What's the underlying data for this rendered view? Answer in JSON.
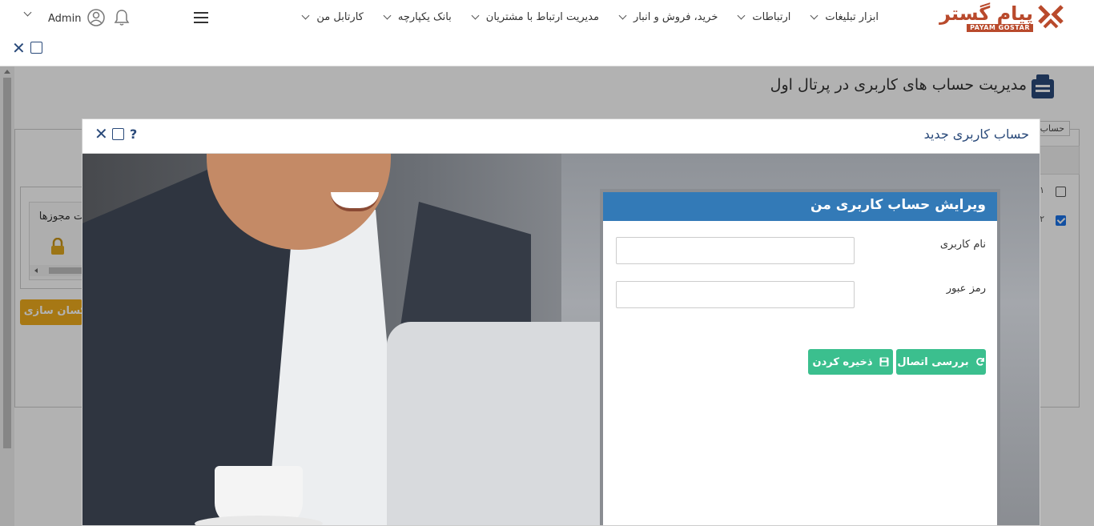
{
  "topbar": {
    "logo_text": "پیام گستر",
    "logo_sub": "PAYAM GOSTAR",
    "menu": [
      {
        "label": "کارتابل من"
      },
      {
        "label": "بانک یکپارچه"
      },
      {
        "label": "مدیریت ارتباط با مشتریان"
      },
      {
        "label": "خرید، فروش و انبار"
      },
      {
        "label": "ارتباطات"
      },
      {
        "label": "ابزار تبلیغات"
      }
    ],
    "user_name": "Admin"
  },
  "outer_window": {
    "close_glyph": "✕"
  },
  "page": {
    "title": "مدیریت حساب های کاربری در پرتال اول",
    "tab_label": "حساب",
    "row_numbers": [
      "۱",
      "۲"
    ],
    "perm_label": "مدیریت مجوزها",
    "update_button": "یکسان سازی خطوط"
  },
  "modal": {
    "title": "حساب کاربری جدید",
    "close_glyph": "✕",
    "help_glyph": "?",
    "card": {
      "title": "ویرایش حساب کاربری من",
      "username_label": "نام کاربری",
      "username_value": "",
      "password_label": "رمز عبور",
      "password_value": "",
      "check_button": "بررسی اتصال",
      "save_button": "ذخیره کردن"
    }
  },
  "colors": {
    "brand": "#b94a2c",
    "accent": "#337ab7",
    "success": "#3bbf8e",
    "warning": "#f0ad1e",
    "header_text": "#2a4a7a"
  }
}
